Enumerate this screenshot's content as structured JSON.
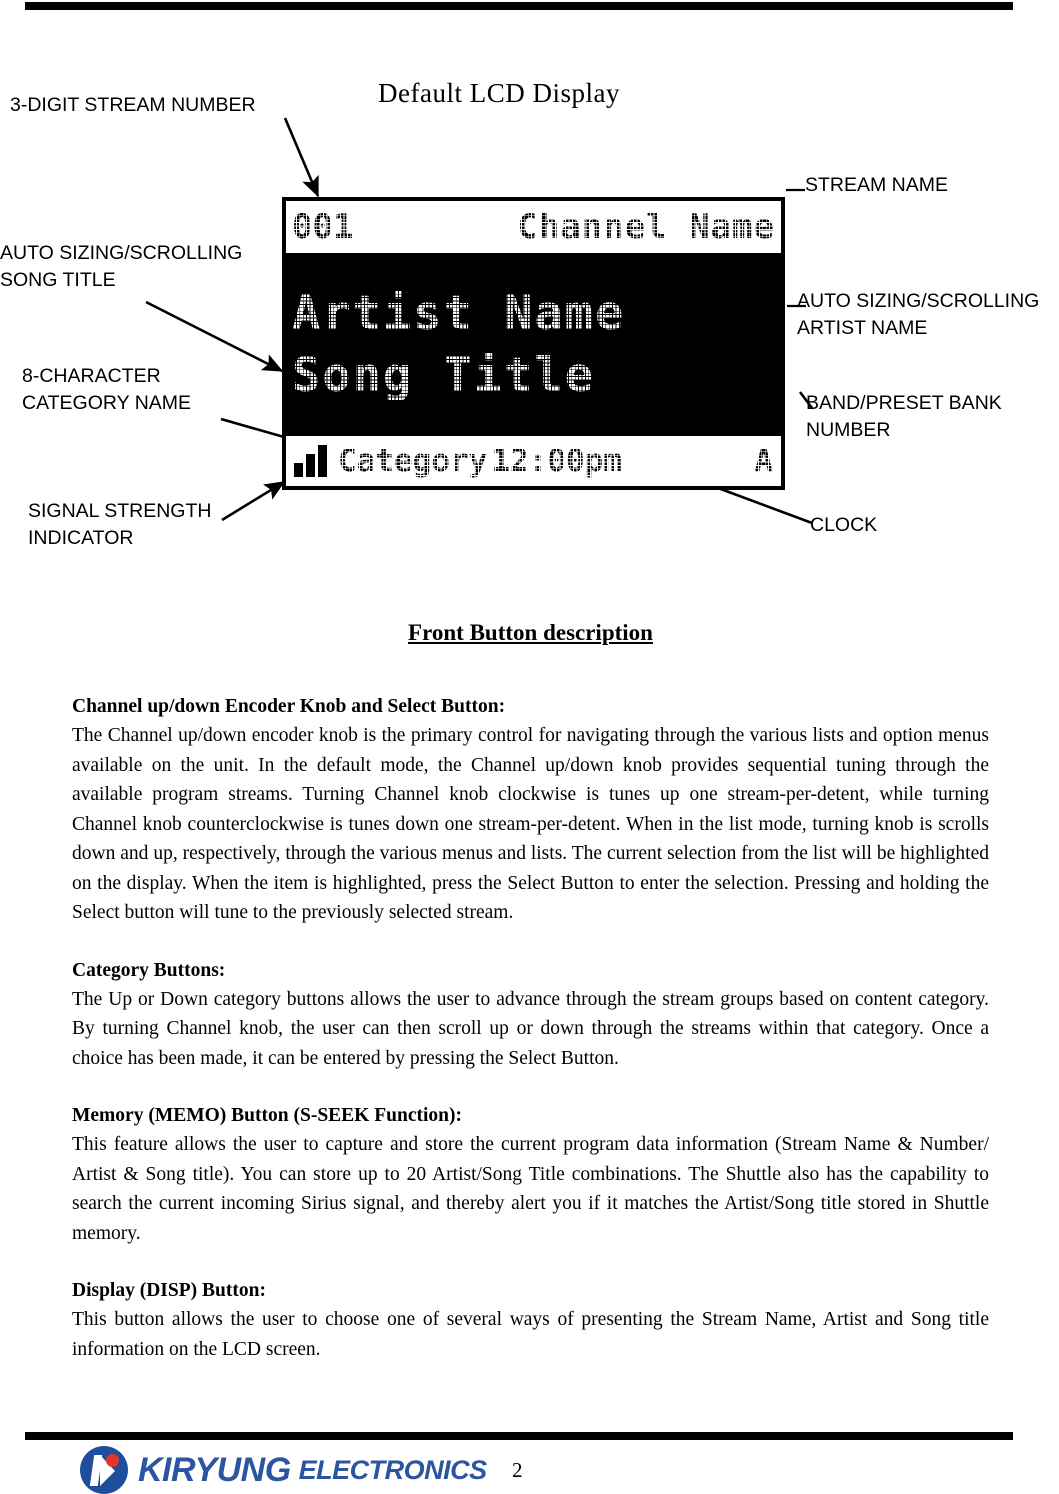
{
  "page": {
    "number": "2"
  },
  "diagram": {
    "title": "Default LCD Display",
    "callouts": {
      "stream_number": "3-DIGIT STREAM NUMBER",
      "song_title_line1": "AUTO SIZING/SCROLLING",
      "song_title_line2": "SONG TITLE",
      "category_line1": "8-CHARACTER",
      "category_line2": "CATEGORY NAME",
      "signal_line1": "SIGNAL STRENGTH",
      "signal_line2": "INDICATOR",
      "stream_name": "STREAM NAME",
      "artist_line1": "AUTO SIZING/SCROLLING",
      "artist_line2": "ARTIST NAME",
      "band_line1": "BAND/PRESET BANK",
      "band_line2": "NUMBER",
      "clock": "CLOCK"
    },
    "lcd": {
      "stream_number": "001",
      "stream_name": "Channel Name",
      "artist_name": "Artist Name",
      "song_title": "Song Title",
      "category": "Category",
      "clock": "12:00pm",
      "band": "A",
      "signal_icon": "signal-bars-icon"
    }
  },
  "content": {
    "section_title": "Front Button description",
    "sections": [
      {
        "heading": "Channel up/down Encoder Knob and Select Button:",
        "body": "The Channel up/down encoder knob is the primary control for navigating through the various lists and option menus available on the unit. In the default mode, the Channel up/down knob provides sequential tuning through the available program streams. Turning Channel knob clockwise is tunes up one stream-per-detent, while turning Channel knob counterclockwise is tunes down one stream-per-detent. When in the list mode, turning knob is scrolls down and up, respectively, through the various menus and lists. The current selection from the list will be highlighted on the display. When the item is highlighted, press the Select Button to enter the selection. Pressing and holding the Select button will tune to the previously selected stream."
      },
      {
        "heading": "Category Buttons:",
        "body": "The Up or Down category buttons allows the user to advance through the stream groups based on content category. By turning Channel knob, the user can then scroll up or down through the streams within that category. Once a choice has been made, it can be entered by pressing the Select Button."
      },
      {
        "heading": "Memory (MEMO) Button (S-SEEK Function):",
        "body": "This feature allows the user to capture and store the current program data information (Stream Name & Number/ Artist & Song title). You can store up to 20 Artist/Song Title combinations. The Shuttle also has the capability to search the current incoming Sirius signal, and thereby alert you if it matches the Artist/Song title stored in Shuttle memory."
      },
      {
        "heading": "Display (DISP) Button:",
        "body": "This button allows the user to choose one of several ways of presenting the Stream Name, Artist and Song title information on the LCD screen."
      }
    ]
  },
  "footer": {
    "company_main": "KIRYUNG",
    "company_sub": "ELECTRONICS",
    "logo_colors": {
      "circle": "#1f4e9c",
      "dot": "#e8342a",
      "text": "#2c55a0"
    }
  }
}
